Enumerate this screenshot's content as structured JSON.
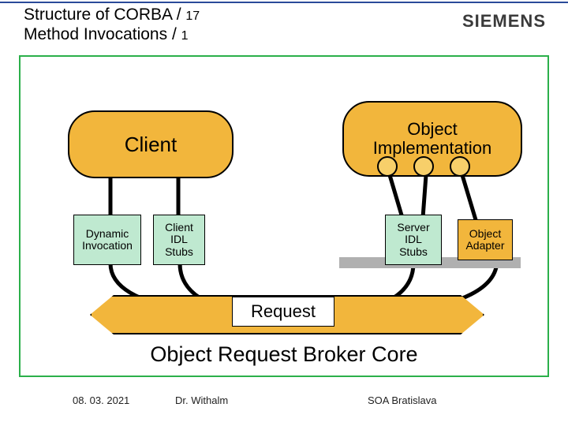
{
  "header": {
    "line1_pre": "Structure of CORBA / ",
    "line1_num": "17",
    "line2_pre": "Method Invocations / ",
    "line2_num": "1",
    "logo": "SIEMENS"
  },
  "blocks": {
    "client": "Client",
    "object_impl_l1": "Object",
    "object_impl_l2": "Implementation",
    "dynamic_l1": "Dynamic",
    "dynamic_l2": "Invocation",
    "client_idl_l1": "Client",
    "client_idl_l2": "IDL",
    "client_idl_l3": "Stubs",
    "server_idl_l1": "Server",
    "server_idl_l2": "IDL",
    "server_idl_l3": "Stubs",
    "object_adapter_l1": "Object",
    "object_adapter_l2": "Adapter",
    "request": "Request",
    "orb_core": "Object Request Broker Core"
  },
  "footer": {
    "date": "08. 03. 2021",
    "author": "Dr. Withalm",
    "place": "SOA Bratislava"
  },
  "colors": {
    "orange": "#f2b63c",
    "mint": "#bfe9d0",
    "green_frame": "#2bb04a"
  }
}
